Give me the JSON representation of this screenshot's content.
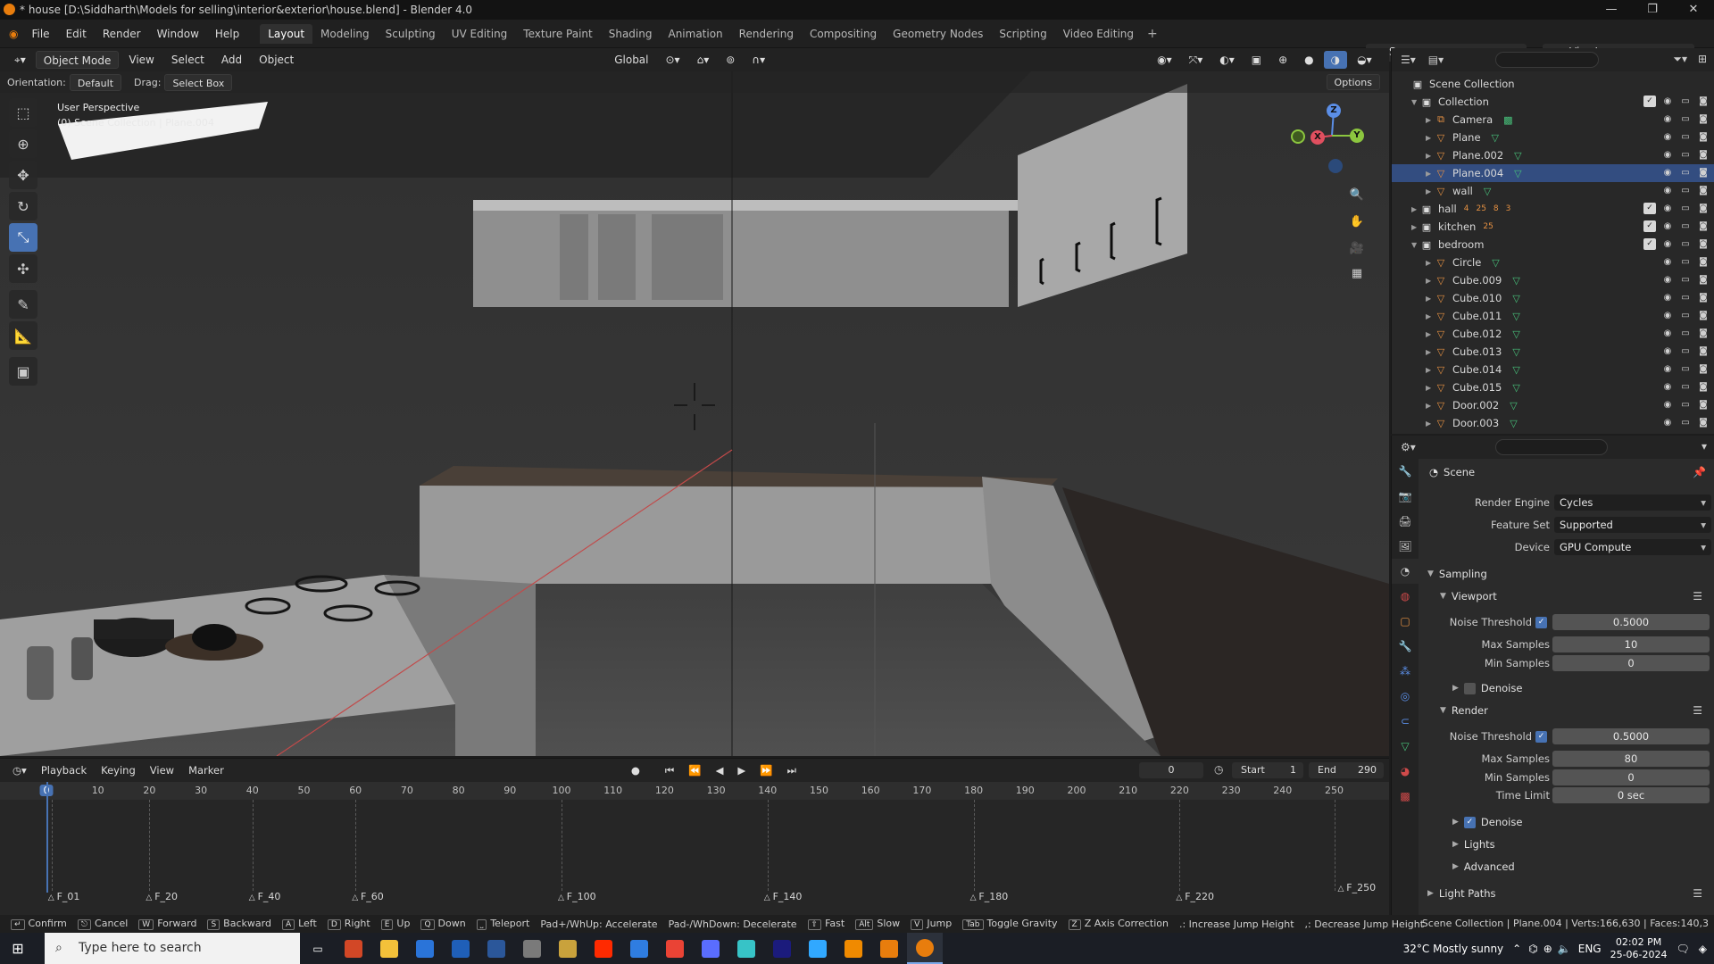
{
  "window": {
    "title": "* house [D:\\Siddharth\\Models for selling\\interior&exterior\\house.blend] - Blender 4.0",
    "minimize": "—",
    "maximize": "❐",
    "close": "✕"
  },
  "menubar": {
    "items": [
      "File",
      "Edit",
      "Render",
      "Window",
      "Help"
    ],
    "workspaces": [
      "Layout",
      "Modeling",
      "Sculpting",
      "UV Editing",
      "Texture Paint",
      "Shading",
      "Animation",
      "Rendering",
      "Compositing",
      "Geometry Nodes",
      "Scripting",
      "Video Editing"
    ],
    "active_workspace": "Layout",
    "add_workspace": "+",
    "scene": "Scene",
    "view_layer": "ViewLayer"
  },
  "viewport": {
    "mode": "Object Mode",
    "menus": [
      "View",
      "Select",
      "Add",
      "Object"
    ],
    "transform_space": "Global",
    "orientation_label": "Orientation:",
    "orientation_value": "Default",
    "drag_label": "Drag:",
    "drag_value": "Select Box",
    "options": "Options",
    "overlay_line1": "User Perspective",
    "overlay_line2": "(0) Scene Collection | Plane.004",
    "gizmo_axes": {
      "x": "X",
      "y": "Y",
      "z": "Z"
    }
  },
  "outliner": {
    "root": "Scene Collection",
    "rows": [
      {
        "name": "Collection",
        "kind": "collection",
        "indent": 1,
        "expanded": true
      },
      {
        "name": "Camera",
        "kind": "camera",
        "indent": 2
      },
      {
        "name": "Plane",
        "kind": "mesh",
        "indent": 2
      },
      {
        "name": "Plane.002",
        "kind": "mesh",
        "indent": 2
      },
      {
        "name": "Plane.004",
        "kind": "mesh",
        "indent": 2,
        "selected": true
      },
      {
        "name": "wall",
        "kind": "mesh",
        "indent": 2
      },
      {
        "name": "hall",
        "kind": "collection",
        "indent": 1,
        "expanded": false
      },
      {
        "name": "kitchen",
        "kind": "collection",
        "indent": 1,
        "expanded": false
      },
      {
        "name": "bedroom",
        "kind": "collection",
        "indent": 1,
        "expanded": true
      },
      {
        "name": "Circle",
        "kind": "mesh",
        "indent": 2
      },
      {
        "name": "Cube.009",
        "kind": "mesh",
        "indent": 2
      },
      {
        "name": "Cube.010",
        "kind": "mesh",
        "indent": 2
      },
      {
        "name": "Cube.011",
        "kind": "mesh",
        "indent": 2
      },
      {
        "name": "Cube.012",
        "kind": "mesh",
        "indent": 2
      },
      {
        "name": "Cube.013",
        "kind": "mesh",
        "indent": 2
      },
      {
        "name": "Cube.014",
        "kind": "mesh",
        "indent": 2
      },
      {
        "name": "Cube.015",
        "kind": "mesh",
        "indent": 2
      },
      {
        "name": "Door.002",
        "kind": "mesh",
        "indent": 2
      },
      {
        "name": "Door.003",
        "kind": "mesh",
        "indent": 2
      }
    ],
    "hall_counts": [
      "4",
      "25",
      "8",
      "3"
    ],
    "kitchen_counts": [
      "25"
    ]
  },
  "properties": {
    "context": "Scene",
    "render_engine_label": "Render Engine",
    "render_engine": "Cycles",
    "feature_set_label": "Feature Set",
    "feature_set": "Supported",
    "device_label": "Device",
    "device": "GPU Compute",
    "sampling": "Sampling",
    "viewport_panel": "Viewport",
    "noise_threshold_label": "Noise Threshold",
    "viewport_noise_threshold": "0.5000",
    "max_samples_label": "Max Samples",
    "viewport_max_samples": "10",
    "min_samples_label": "Min Samples",
    "viewport_min_samples": "0",
    "denoise": "Denoise",
    "render_panel": "Render",
    "render_noise_threshold": "0.5000",
    "render_max_samples": "80",
    "render_min_samples": "0",
    "time_limit_label": "Time Limit",
    "time_limit": "0 sec",
    "lights": "Lights",
    "advanced": "Advanced",
    "light_paths": "Light Paths"
  },
  "timeline": {
    "menus": [
      "Playback",
      "Keying",
      "View",
      "Marker"
    ],
    "current_frame": "0",
    "start_label": "Start",
    "start": "1",
    "end_label": "End",
    "end": "290",
    "ticks": [
      "0",
      "10",
      "20",
      "30",
      "40",
      "50",
      "60",
      "70",
      "80",
      "90",
      "100",
      "110",
      "120",
      "130",
      "140",
      "150",
      "160",
      "170",
      "180",
      "190",
      "200",
      "210",
      "220",
      "230",
      "240",
      "250"
    ],
    "markers": [
      "F_01",
      "F_20",
      "F_40",
      "F_60",
      "F_100",
      "F_140",
      "F_180",
      "F_220",
      "F_250"
    ]
  },
  "statusbar": {
    "items": [
      {
        "key": "↵",
        "label": "Confirm"
      },
      {
        "key": "⎋",
        "label": "Cancel"
      },
      {
        "key": "W",
        "label": "Forward"
      },
      {
        "key": "S",
        "label": "Backward"
      },
      {
        "key": "A",
        "label": "Left"
      },
      {
        "key": "D",
        "label": "Right"
      },
      {
        "key": "E",
        "label": "Up"
      },
      {
        "key": "Q",
        "label": "Down"
      },
      {
        "key": "⎵",
        "label": "Teleport"
      },
      {
        "key": "",
        "label": "Pad+/WhUp: Accelerate"
      },
      {
        "key": "",
        "label": "Pad-/WhDown: Decelerate"
      },
      {
        "key": "⇧",
        "label": "Fast"
      },
      {
        "key": "Alt",
        "label": "Slow"
      },
      {
        "key": "V",
        "label": "Jump"
      },
      {
        "key": "Tab",
        "label": "Toggle Gravity"
      },
      {
        "key": "Z",
        "label": "Z Axis Correction"
      },
      {
        "key": "",
        "label": ".: Increase Jump Height"
      },
      {
        "key": "",
        "label": ",: Decrease Jump Height"
      }
    ],
    "scene_stats": "Scene Collection | Plane.004 | Verts:166,630 | Faces:140,3"
  },
  "taskbar": {
    "search_placeholder": "Type here to search",
    "weather": "32°C  Mostly sunny",
    "lang": "ENG",
    "time": "02:02 PM",
    "date": "25-06-2024",
    "app_colors": [
      "#d24726",
      "#f3c13a",
      "#2a74d9",
      "#1f5fb8",
      "#2b579a",
      "#7a7a7a",
      "#c9a23c",
      "#ff2a00",
      "#2f7de1",
      "#ea4335",
      "#5a6dff",
      "#37c3c7",
      "#1b1b7c",
      "#31a8ff",
      "#f08a00",
      "#e87d0d",
      "#e87d0d"
    ]
  }
}
